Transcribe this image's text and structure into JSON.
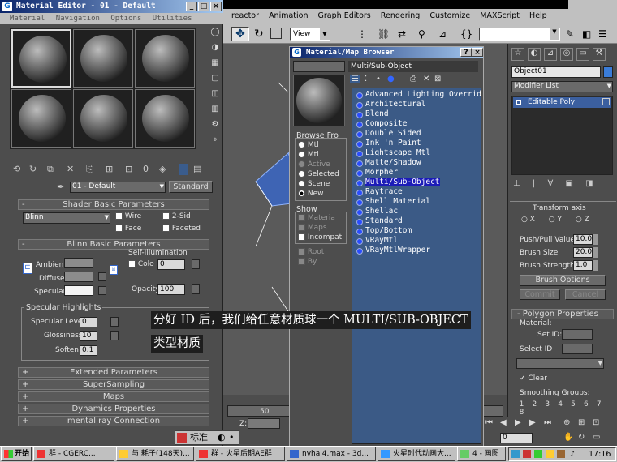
{
  "main_menu": [
    "reactor",
    "Animation",
    "Graph Editors",
    "Rendering",
    "Customize",
    "MAXScript",
    "Help"
  ],
  "viewport_dropdown": "View",
  "mat_editor": {
    "title": "Material Editor - 01 - Default",
    "menu": [
      "Material",
      "Navigation",
      "Options",
      "Utilities"
    ],
    "mat_name": "01 - Default",
    "mat_type": "Standard",
    "rollouts": {
      "shader": "Shader Basic Parameters",
      "blinn": "Blinn Basic Parameters",
      "extended": "Extended Parameters",
      "supersampling": "SuperSampling",
      "maps": "Maps",
      "dynamics": "Dynamics Properties",
      "mental_ray": "mental ray Connection"
    },
    "shader_type": "Blinn",
    "wire": "Wire",
    "two_sided": "2-Sid",
    "face": "Face",
    "faceted": "Faceted",
    "ambient": "Ambient:",
    "diffuse": "Diffuse:",
    "specular": "Specular:",
    "self_illum": "Self-Illumination",
    "color": "Colo",
    "self_illum_value": "0",
    "opacity_label": "Opacity:",
    "opacity_value": "100",
    "spec_highlights": "Specular Highlights",
    "spec_level_label": "Specular Level:",
    "spec_level": "0",
    "glossiness_label": "Glossiness:",
    "glossiness": "10",
    "soften_label": "Soften:",
    "soften": "0.1",
    "colors": {
      "ambient": "#8c8c8c",
      "diffuse": "#8c8c8c",
      "specular": "#f4f4f4"
    }
  },
  "browser": {
    "title": "Material/Map Browser",
    "selected_name": "Multi/Sub-Object",
    "browse_from": "Browse Fro",
    "browse_options": [
      "Mtl",
      "Mtl",
      "Active",
      "Selected",
      "Scene",
      "New"
    ],
    "show_label": "Show",
    "show_options": [
      "Materia",
      "Maps",
      "Incompat"
    ],
    "root_options": [
      "Root",
      "By"
    ],
    "items": [
      "Advanced Lighting Override",
      "Architectural",
      "Blend",
      "Composite",
      "Double Sided",
      "Ink 'n Paint",
      "Lightscape Mtl",
      "Matte/Shadow",
      "Morpher",
      "Multi/Sub-Object",
      "Raytrace",
      "Shell Material",
      "Shellac",
      "Standard",
      "Top/Bottom",
      "VRayMtl",
      "VRayMtlWrapper"
    ],
    "selected_index": 9
  },
  "command_panel": {
    "object_name": "Object01",
    "modifier_list": "Modifier List",
    "stack_item": "Editable Poly",
    "transform_axis": "Transform axis",
    "axes": [
      "X",
      "Y",
      "Z"
    ],
    "push_pull_label": "Push/Pull Value",
    "push_pull": "10.0",
    "brush_size_label": "Brush Size",
    "brush_size": "20.0",
    "brush_strength_label": "Brush Strength",
    "brush_strength": "1.0",
    "brush_options": "Brush Options",
    "commit": "Commit",
    "cancel": "Cancel",
    "poly_props": "Polygon Properties",
    "material_label": "Material:",
    "set_id": "Set ID:",
    "select_id": "Select ID",
    "clear": "Clear",
    "smoothing_groups": "Smoothing Groups:",
    "sg_numbers": [
      "1",
      "2",
      "3",
      "4",
      "5",
      "6",
      "7",
      "8"
    ]
  },
  "timeline": {
    "frame_50": "50",
    "z_label": "Z:",
    "frame_field": "0"
  },
  "caption": {
    "line1": "分好 ID 后，我们给任意材质球一个 MULTI/SUB-OBJECT",
    "line2": "类型材质"
  },
  "ime": {
    "label": "标准"
  },
  "taskbar": {
    "start": "开始",
    "buttons": [
      "群 - CGERC...",
      "与 耗子(148天)...",
      "群 - 火星后期AE群",
      "nvhai4.max - 3d...",
      "火星时代动画大...",
      "4 - 画图"
    ],
    "clock": "17:16"
  }
}
